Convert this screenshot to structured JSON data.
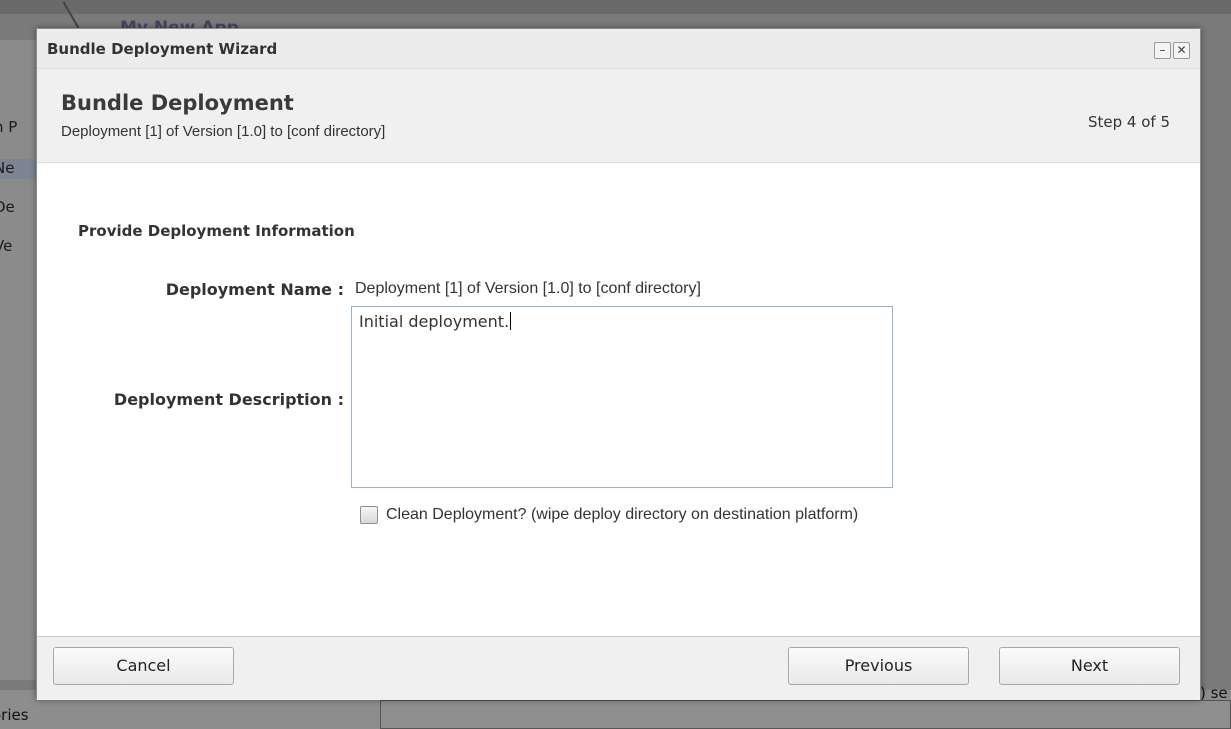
{
  "background": {
    "app_title": "My New App",
    "left_items": [
      "n P",
      "Ne",
      "De",
      "Ve"
    ],
    "bottom_label": "ories",
    "right_label": ") se"
  },
  "dialog": {
    "window_title": "Bundle Deployment Wizard",
    "minimize_label": "–",
    "close_label": "✕",
    "header": {
      "title": "Bundle Deployment",
      "subtitle": "Deployment [1] of Version [1.0] to [conf directory]",
      "step": "Step 4 of 5"
    },
    "form": {
      "section_title": "Provide Deployment Information",
      "name_label": "Deployment Name :",
      "name_value": "Deployment [1] of Version [1.0] to [conf directory]",
      "description_label": "Deployment Description :",
      "description_value": "Initial deployment.",
      "clean_label": "Clean Deployment? (wipe deploy directory on destination platform)",
      "clean_checked": false
    },
    "buttons": {
      "cancel": "Cancel",
      "previous": "Previous",
      "next": "Next"
    }
  },
  "colors": {
    "overlay": "#7a7a7a",
    "header_bg": "#f0f0f0",
    "textbox_border": "#9cb0c8"
  }
}
